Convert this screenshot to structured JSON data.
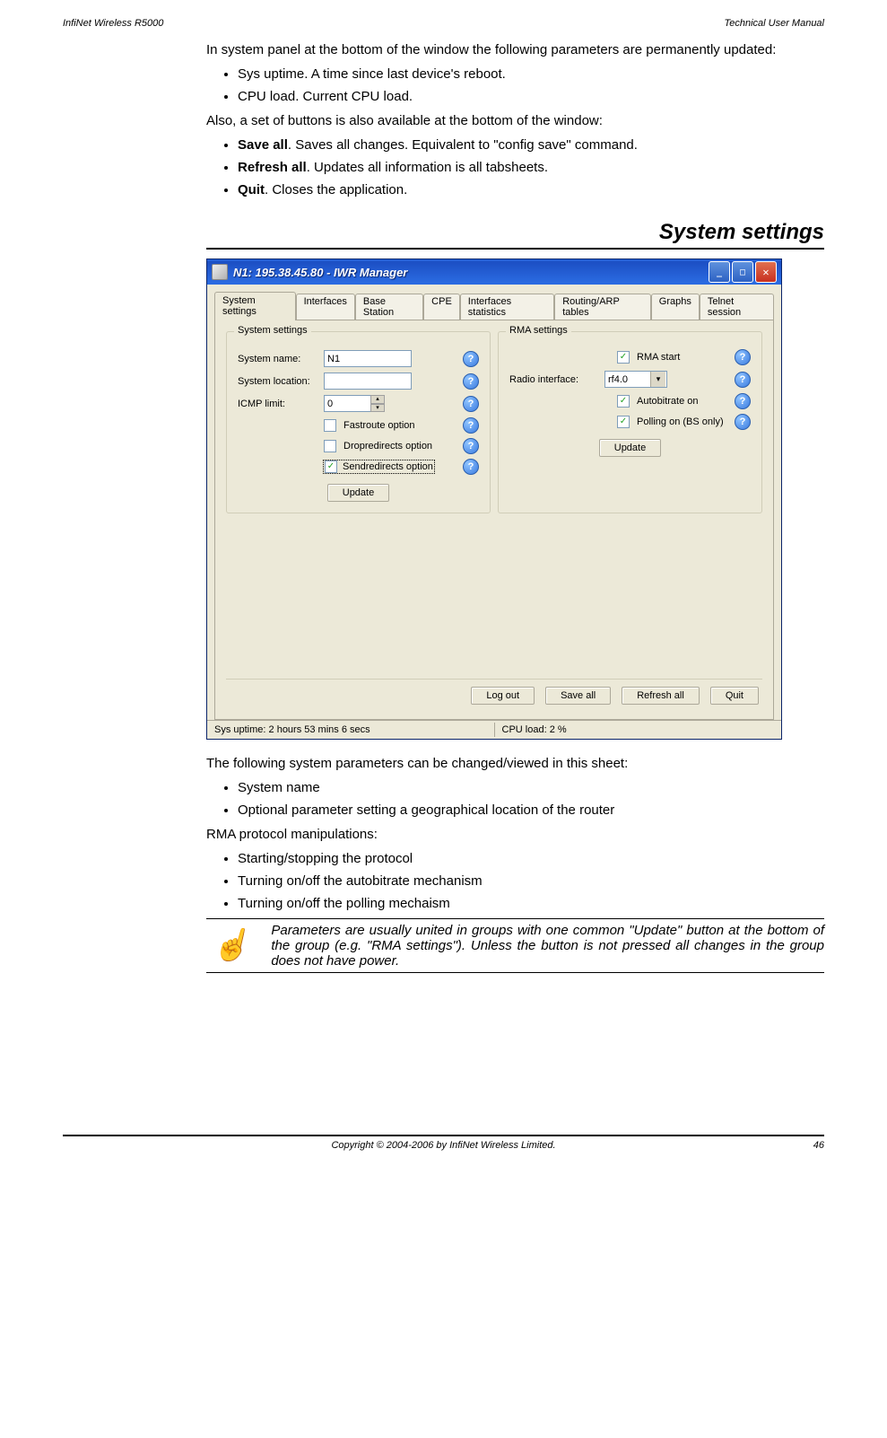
{
  "header": {
    "left": "InfiNet Wireless R5000",
    "right": "Technical User Manual"
  },
  "intro": "In system panel at the bottom of the window the following parameters are permanently updated:",
  "intro_bullets": [
    "Sys uptime. A time since last device's reboot.",
    "CPU load. Current CPU load."
  ],
  "also_text": "Also, a set of buttons is also available at the bottom of the window:",
  "also_bullets": [
    {
      "b": "Save all",
      "t": ". Saves all changes. Equivalent to \"config save\" command."
    },
    {
      "b": "Refresh all",
      "t": ". Updates all information is all tabsheets."
    },
    {
      "b": "Quit",
      "t": ". Closes the application."
    }
  ],
  "section_heading": "System settings",
  "screenshot": {
    "title": "N1: 195.38.45.80 - IWR Manager",
    "tabs": [
      "System settings",
      "Interfaces",
      "Base Station",
      "CPE",
      "Interfaces statistics",
      "Routing/ARP tables",
      "Graphs",
      "Telnet session"
    ],
    "group_system": {
      "legend": "System settings",
      "system_name_label": "System name:",
      "system_name_value": "N1",
      "system_location_label": "System location:",
      "system_location_value": "",
      "icmp_label": "ICMP limit:",
      "icmp_value": "0",
      "fastroute_label": "Fastroute option",
      "dropredirects_label": "Dropredirects option",
      "sendredirects_label": "Sendredirects option",
      "update_btn": "Update"
    },
    "group_rma": {
      "legend": "RMA settings",
      "rma_start_label": "RMA start",
      "radio_if_label": "Radio interface:",
      "radio_if_value": "rf4.0",
      "autobitrate_label": "Autobitrate on",
      "polling_label": "Polling on (BS only)",
      "update_btn": "Update"
    },
    "bottom_buttons": [
      "Log out",
      "Save all",
      "Refresh all",
      "Quit"
    ],
    "status": {
      "uptime": "Sys uptime: 2 hours 53 mins 6 secs",
      "cpu": "CPU load: 2 %"
    }
  },
  "after_text": "The following system parameters can be changed/viewed in this sheet:",
  "after_bullets": [
    "System name",
    "Optional parameter setting a geographical location of the router"
  ],
  "rma_text": "RMA protocol manipulations:",
  "rma_bullets": [
    "Starting/stopping the protocol",
    "Turning on/off the autobitrate mechanism",
    "Turning on/off the polling mechaism"
  ],
  "note": "Parameters are usually united in groups with one common \"Update\" button at the bottom of the group (e.g. \"RMA settings\"). Unless the button is not pressed all changes in the group does not have power.",
  "footer": {
    "center": "Copyright © 2004-2006 by InfiNet Wireless Limited.",
    "page": "46"
  }
}
